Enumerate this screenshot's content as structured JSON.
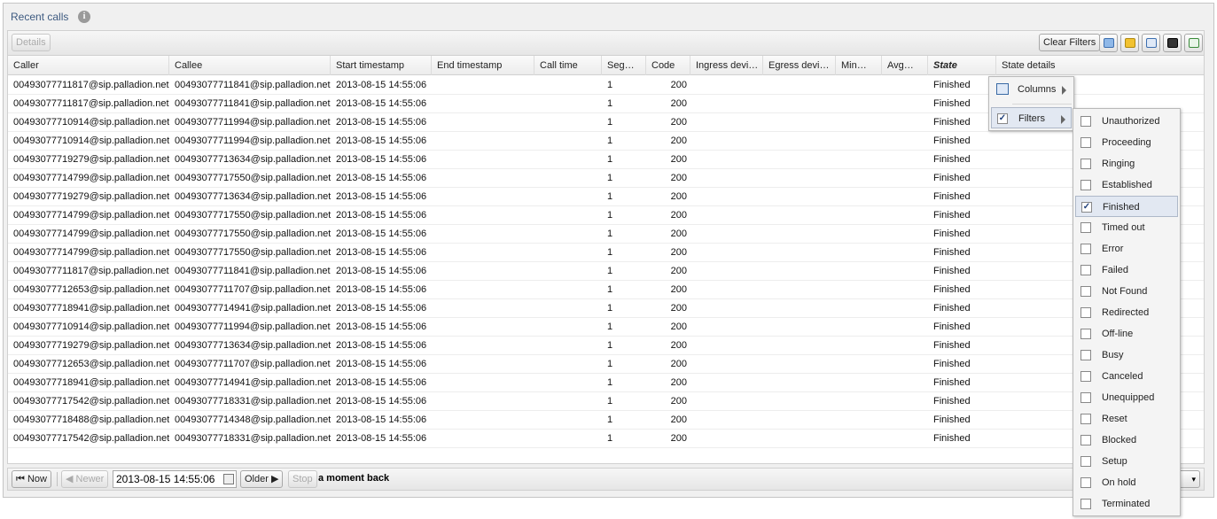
{
  "panel": {
    "title": "Recent calls",
    "info_icon": "info-icon"
  },
  "toolbar": {
    "details_label": "Details",
    "clear_filters_label": "Clear Filters",
    "icons": [
      "refresh-icon",
      "open-folder-icon",
      "export-icon",
      "save-icon",
      "download-icon"
    ]
  },
  "columns": [
    {
      "label": "Caller"
    },
    {
      "label": "Callee"
    },
    {
      "label": "Start timestamp"
    },
    {
      "label": "End timestamp"
    },
    {
      "label": "Call time"
    },
    {
      "label": "Seg…"
    },
    {
      "label": "Code"
    },
    {
      "label": "Ingress devi…"
    },
    {
      "label": "Egress devi…"
    },
    {
      "label": "Min…"
    },
    {
      "label": "Avg…"
    },
    {
      "label": "State"
    },
    {
      "label": "State details"
    }
  ],
  "rows": [
    [
      "00493077711817@sip.palladion.net",
      "00493077711841@sip.palladion.net",
      "2013-08-15 14:55:06",
      "1",
      "200",
      "Finished"
    ],
    [
      "00493077711817@sip.palladion.net",
      "00493077711841@sip.palladion.net",
      "2013-08-15 14:55:06",
      "1",
      "200",
      "Finished"
    ],
    [
      "00493077710914@sip.palladion.net",
      "00493077711994@sip.palladion.net",
      "2013-08-15 14:55:06",
      "1",
      "200",
      "Finished"
    ],
    [
      "00493077710914@sip.palladion.net",
      "00493077711994@sip.palladion.net",
      "2013-08-15 14:55:06",
      "1",
      "200",
      "Finished"
    ],
    [
      "00493077719279@sip.palladion.net",
      "00493077713634@sip.palladion.net",
      "2013-08-15 14:55:06",
      "1",
      "200",
      "Finished"
    ],
    [
      "00493077714799@sip.palladion.net",
      "00493077717550@sip.palladion.net",
      "2013-08-15 14:55:06",
      "1",
      "200",
      "Finished"
    ],
    [
      "00493077719279@sip.palladion.net",
      "00493077713634@sip.palladion.net",
      "2013-08-15 14:55:06",
      "1",
      "200",
      "Finished"
    ],
    [
      "00493077714799@sip.palladion.net",
      "00493077717550@sip.palladion.net",
      "2013-08-15 14:55:06",
      "1",
      "200",
      "Finished"
    ],
    [
      "00493077714799@sip.palladion.net",
      "00493077717550@sip.palladion.net",
      "2013-08-15 14:55:06",
      "1",
      "200",
      "Finished"
    ],
    [
      "00493077714799@sip.palladion.net",
      "00493077717550@sip.palladion.net",
      "2013-08-15 14:55:06",
      "1",
      "200",
      "Finished"
    ],
    [
      "00493077711817@sip.palladion.net",
      "00493077711841@sip.palladion.net",
      "2013-08-15 14:55:06",
      "1",
      "200",
      "Finished"
    ],
    [
      "00493077712653@sip.palladion.net",
      "00493077711707@sip.palladion.net",
      "2013-08-15 14:55:06",
      "1",
      "200",
      "Finished"
    ],
    [
      "00493077718941@sip.palladion.net",
      "00493077714941@sip.palladion.net",
      "2013-08-15 14:55:06",
      "1",
      "200",
      "Finished"
    ],
    [
      "00493077710914@sip.palladion.net",
      "00493077711994@sip.palladion.net",
      "2013-08-15 14:55:06",
      "1",
      "200",
      "Finished"
    ],
    [
      "00493077719279@sip.palladion.net",
      "00493077713634@sip.palladion.net",
      "2013-08-15 14:55:06",
      "1",
      "200",
      "Finished"
    ],
    [
      "00493077712653@sip.palladion.net",
      "00493077711707@sip.palladion.net",
      "2013-08-15 14:55:06",
      "1",
      "200",
      "Finished"
    ],
    [
      "00493077718941@sip.palladion.net",
      "00493077714941@sip.palladion.net",
      "2013-08-15 14:55:06",
      "1",
      "200",
      "Finished"
    ],
    [
      "00493077717542@sip.palladion.net",
      "00493077718331@sip.palladion.net",
      "2013-08-15 14:55:06",
      "1",
      "200",
      "Finished"
    ],
    [
      "00493077718488@sip.palladion.net",
      "00493077714348@sip.palladion.net",
      "2013-08-15 14:55:06",
      "1",
      "200",
      "Finished"
    ],
    [
      "00493077717542@sip.palladion.net",
      "00493077718331@sip.palladion.net",
      "2013-08-15 14:55:06",
      "1",
      "200",
      "Finished"
    ]
  ],
  "pager": {
    "now_label": "Now",
    "newer_label": "Newer",
    "date_value": "2013-08-15 14:55:06",
    "older_label": "Older",
    "stop_label": "Stop",
    "status": "a moment back"
  },
  "column_menu": {
    "columns_label": "Columns",
    "filters_label": "Filters",
    "filters_checked": true
  },
  "filters_menu": [
    {
      "label": "Unauthorized",
      "checked": false
    },
    {
      "label": "Proceeding",
      "checked": false
    },
    {
      "label": "Ringing",
      "checked": false
    },
    {
      "label": "Established",
      "checked": false
    },
    {
      "label": "Finished",
      "checked": true
    },
    {
      "label": "Timed out",
      "checked": false
    },
    {
      "label": "Error",
      "checked": false
    },
    {
      "label": "Failed",
      "checked": false
    },
    {
      "label": "Not Found",
      "checked": false
    },
    {
      "label": "Redirected",
      "checked": false
    },
    {
      "label": "Off-line",
      "checked": false
    },
    {
      "label": "Busy",
      "checked": false
    },
    {
      "label": "Canceled",
      "checked": false
    },
    {
      "label": "Unequipped",
      "checked": false
    },
    {
      "label": "Reset",
      "checked": false
    },
    {
      "label": "Blocked",
      "checked": false
    },
    {
      "label": "Setup",
      "checked": false
    },
    {
      "label": "On hold",
      "checked": false
    },
    {
      "label": "Terminated",
      "checked": false
    }
  ],
  "colors": {
    "title": "#3d5a80",
    "icon_blue": "#4a90d9",
    "icon_yellow": "#f2c230",
    "icon_dark": "#333333",
    "icon_green": "#3a8a3a"
  }
}
